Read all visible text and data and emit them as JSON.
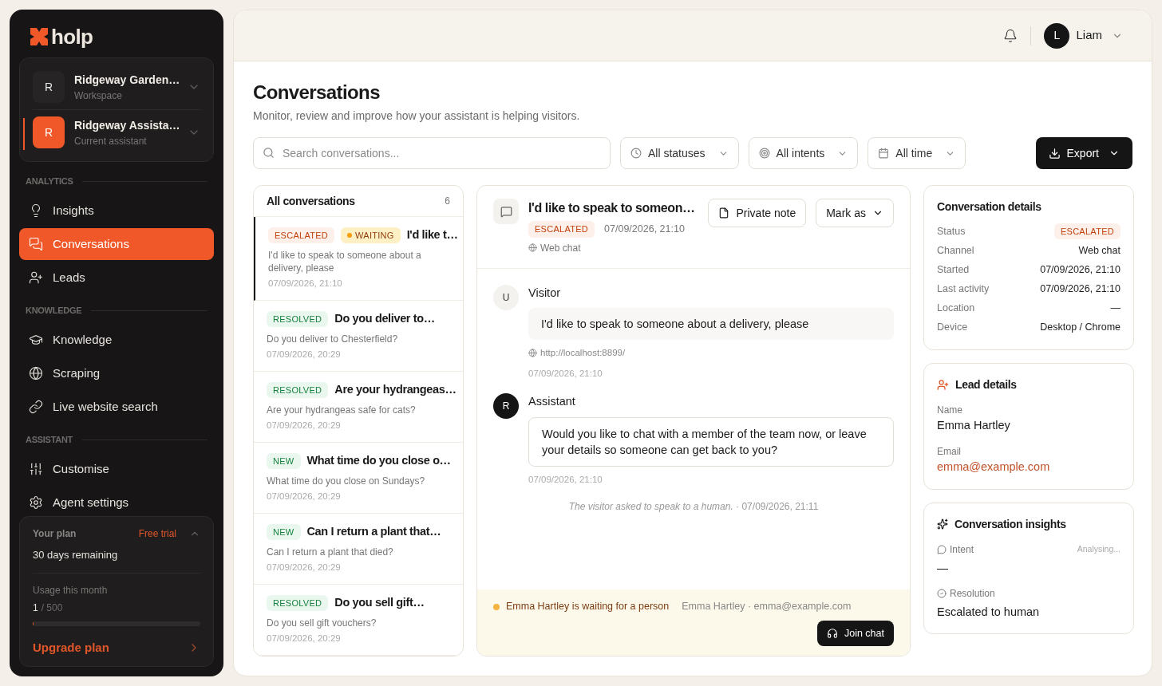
{
  "brand": {
    "name": "holp"
  },
  "switcher": [
    {
      "initial": "R",
      "name": "Ridgeway Garden…",
      "sub": "Workspace",
      "selected": false
    },
    {
      "initial": "R",
      "name": "Ridgeway Assista…",
      "sub": "Current assistant",
      "selected": true
    }
  ],
  "nav_sections": [
    {
      "title": "ANALYTICS",
      "items": [
        {
          "label": "Insights",
          "selected": false
        },
        {
          "label": "Conversations",
          "selected": true
        },
        {
          "label": "Leads",
          "selected": false
        }
      ]
    },
    {
      "title": "KNOWLEDGE",
      "items": [
        {
          "label": "Knowledge",
          "selected": false
        },
        {
          "label": "Scraping",
          "selected": false
        },
        {
          "label": "Live website search",
          "selected": false
        }
      ]
    },
    {
      "title": "ASSISTANT",
      "items": [
        {
          "label": "Customise",
          "selected": false
        },
        {
          "label": "Agent settings",
          "selected": false
        }
      ]
    }
  ],
  "plan": {
    "title": "Your plan",
    "badge": "Free trial",
    "remaining": "30 days remaining",
    "usage_label": "Usage this month",
    "used": "1",
    "limit": "/ 500",
    "level": 0.002,
    "upgrade": "Upgrade plan"
  },
  "user": {
    "initial": "L",
    "name": "Liam"
  },
  "page": {
    "title": "Conversations",
    "subtitle": "Monitor, review and improve how your assistant is helping visitors."
  },
  "search": {
    "placeholder": "Search conversations..."
  },
  "filters": [
    "All statuses",
    "All intents",
    "All time"
  ],
  "export_button": "Export",
  "list": {
    "title": "All conversations",
    "count": "6",
    "items": [
      {
        "badges": [
          {
            "kind": "escalated",
            "label": "ESCALATED"
          },
          {
            "kind": "waiting",
            "label": "WAITING"
          }
        ],
        "title": "I'd like t…",
        "preview": "I'd like to speak to someone about a delivery, please",
        "time": "07/09/2026, 21:10",
        "selected": true
      },
      {
        "badges": [
          {
            "kind": "resolved",
            "label": "RESOLVED"
          }
        ],
        "title": "Do you deliver to…",
        "preview": "Do you deliver to Chesterfield?",
        "time": "07/09/2026, 20:29",
        "selected": false
      },
      {
        "badges": [
          {
            "kind": "resolved",
            "label": "RESOLVED"
          }
        ],
        "title": "Are your hydrangeas…",
        "preview": "Are your hydrangeas safe for cats?",
        "time": "07/09/2026, 20:29",
        "selected": false
      },
      {
        "badges": [
          {
            "kind": "new",
            "label": "NEW"
          }
        ],
        "title": "What time do you close o…",
        "preview": "What time do you close on Sundays?",
        "time": "07/09/2026, 20:29",
        "selected": false
      },
      {
        "badges": [
          {
            "kind": "new",
            "label": "NEW"
          }
        ],
        "title": "Can I return a plant that…",
        "preview": "Can I return a plant that died?",
        "time": "07/09/2026, 20:29",
        "selected": false
      },
      {
        "badges": [
          {
            "kind": "resolved",
            "label": "RESOLVED"
          }
        ],
        "title": "Do you sell gift…",
        "preview": "Do you sell gift vouchers?",
        "time": "07/09/2026, 20:29",
        "selected": false
      }
    ]
  },
  "chat": {
    "title": "I'd like to speak to someon…",
    "badge": {
      "kind": "escalated",
      "label": "ESCALATED"
    },
    "time": "07/09/2026, 21:10",
    "channel": "Web chat",
    "private_note": "Private note",
    "mark_as": "Mark as",
    "messages": [
      {
        "kind": "visitor",
        "initial": "U",
        "author": "Visitor",
        "text": "I'd like to speak to someone about a delivery, please",
        "url": "http://localhost:8899/",
        "time": "07/09/2026, 21:10"
      },
      {
        "kind": "assistant",
        "initial": "R",
        "author": "Assistant",
        "text": "Would you like to chat with a member of the team now, or leave your details so someone can get back to you?",
        "time": "07/09/2026, 21:10"
      }
    ],
    "event": "*The visitor asked to speak to a human.* · 07/09/2026, 21:11",
    "waiting": {
      "text": "Emma Hartley is waiting for a person",
      "contact": "Emma Hartley · emma@example.com",
      "button": "Join chat"
    }
  },
  "details": {
    "title": "Conversation details",
    "rows": [
      {
        "label": "Status",
        "kind": "badge",
        "badge": {
          "kind": "escalated",
          "label": "ESCALATED"
        }
      },
      {
        "label": "Channel",
        "kind": "text",
        "value": "Web chat"
      },
      {
        "label": "Started",
        "kind": "text",
        "value": "07/09/2026, 21:10"
      },
      {
        "label": "Last activity",
        "kind": "text",
        "value": "07/09/2026, 21:10"
      },
      {
        "label": "Location",
        "kind": "text",
        "value": "—"
      },
      {
        "label": "Device",
        "kind": "text",
        "value": "Desktop / Chrome"
      }
    ]
  },
  "lead": {
    "title": "Lead details",
    "name_label": "Name",
    "name": "Emma Hartley",
    "email_label": "Email",
    "email": "emma@example.com"
  },
  "insights": {
    "title": "Conversation insights",
    "intent_label": "Intent",
    "intent_status": "Analysing...",
    "intent_value": "—",
    "resolution_label": "Resolution",
    "resolution_value": "Escalated to human"
  }
}
